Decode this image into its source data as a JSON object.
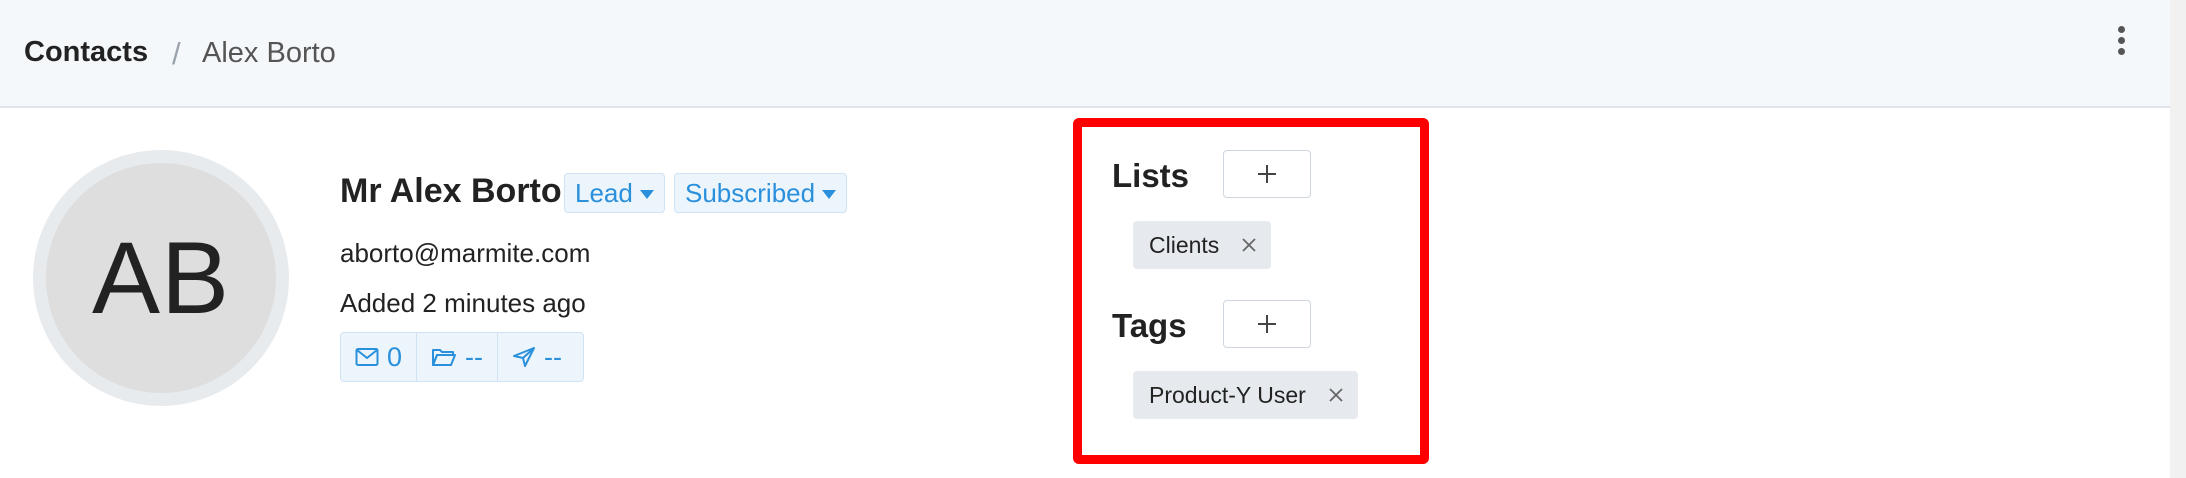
{
  "breadcrumb": {
    "root": "Contacts",
    "separator": "/",
    "current": "Alex Borto"
  },
  "header": {
    "menu_icon": "vertical-ellipsis-icon"
  },
  "contact": {
    "initials": "AB",
    "name": "Mr Alex Borto",
    "status_label": "Lead",
    "subscription_label": "Subscribed",
    "email": "aborto@marmite.com",
    "added": "Added 2 minutes ago",
    "stats": {
      "emails": "0",
      "folders": "--",
      "campaigns": "--"
    }
  },
  "lists": {
    "title": "Lists",
    "items": [
      "Clients"
    ]
  },
  "tags": {
    "title": "Tags",
    "items": [
      "Product-Y User"
    ]
  },
  "colors": {
    "accent": "#2a90dc",
    "highlight": "#ff0000",
    "header_bg": "#f5f8fb",
    "chip_bg": "#e6eaee"
  }
}
